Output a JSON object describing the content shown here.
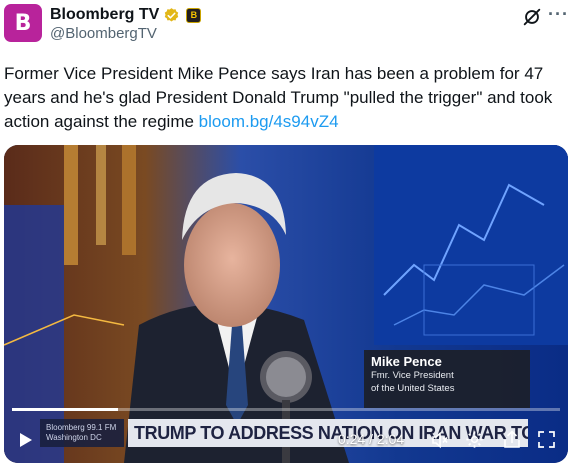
{
  "author": {
    "avatar_letter": "B",
    "display_name": "Bloomberg TV",
    "handle": "@BloombergTV",
    "affiliate_badge_letter": "B",
    "avatar_color": "#b8239b"
  },
  "tweet": {
    "text": "Former Vice President Mike Pence says Iran has been a problem for 47 years and he's glad President Donald Trump \"pulled the trigger\" and took action against the regime ",
    "link_text": "bloom.bg/4s94vZ4",
    "link_color": "#1d9bf0"
  },
  "video": {
    "lower_third": {
      "name": "Mike Pence",
      "title_line1": "Fmr. Vice President",
      "title_line2": "of the United States"
    },
    "station_line1": "Bloomberg 99.1 FM",
    "station_line2": "Washington DC",
    "ticker": "TRUMP TO ADDRESS NATION ON IRAN WAR TONIGHT",
    "time_display": "0:24 / 2:04",
    "progress_fraction": 0.194
  },
  "icons": {
    "verified": "verified-gold-badge-icon",
    "grok": "grok-icon",
    "more": "more-icon",
    "play": "play-icon",
    "volume": "volume-icon",
    "settings": "settings-gear-icon",
    "share": "share-icon",
    "fullscreen": "fullscreen-icon"
  },
  "more_label": "···"
}
